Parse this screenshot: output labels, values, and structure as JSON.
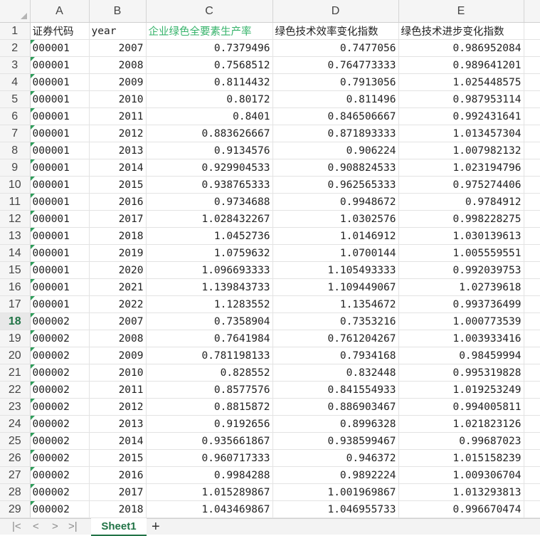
{
  "columns": [
    "A",
    "B",
    "C",
    "D",
    "E"
  ],
  "header_row": {
    "row_num": "1",
    "a": "证券代码",
    "b": "year",
    "c": "企业绿色全要素生产率",
    "d": "绿色技术效率变化指数",
    "e": "绿色技术进步变化指数"
  },
  "rows": [
    {
      "n": "2",
      "a": "000001",
      "b": "2007",
      "c": "0.7379496",
      "d": "0.7477056",
      "e": "0.986952084"
    },
    {
      "n": "3",
      "a": "000001",
      "b": "2008",
      "c": "0.7568512",
      "d": "0.764773333",
      "e": "0.989641201"
    },
    {
      "n": "4",
      "a": "000001",
      "b": "2009",
      "c": "0.8114432",
      "d": "0.7913056",
      "e": "1.025448575"
    },
    {
      "n": "5",
      "a": "000001",
      "b": "2010",
      "c": "0.80172",
      "d": "0.811496",
      "e": "0.987953114"
    },
    {
      "n": "6",
      "a": "000001",
      "b": "2011",
      "c": "0.8401",
      "d": "0.846506667",
      "e": "0.992431641"
    },
    {
      "n": "7",
      "a": "000001",
      "b": "2012",
      "c": "0.883626667",
      "d": "0.871893333",
      "e": "1.013457304"
    },
    {
      "n": "8",
      "a": "000001",
      "b": "2013",
      "c": "0.9134576",
      "d": "0.906224",
      "e": "1.007982132"
    },
    {
      "n": "9",
      "a": "000001",
      "b": "2014",
      "c": "0.929904533",
      "d": "0.908824533",
      "e": "1.023194796"
    },
    {
      "n": "10",
      "a": "000001",
      "b": "2015",
      "c": "0.938765333",
      "d": "0.962565333",
      "e": "0.975274406"
    },
    {
      "n": "11",
      "a": "000001",
      "b": "2016",
      "c": "0.9734688",
      "d": "0.9948672",
      "e": "0.9784912"
    },
    {
      "n": "12",
      "a": "000001",
      "b": "2017",
      "c": "1.028432267",
      "d": "1.0302576",
      "e": "0.998228275"
    },
    {
      "n": "13",
      "a": "000001",
      "b": "2018",
      "c": "1.0452736",
      "d": "1.0146912",
      "e": "1.030139613"
    },
    {
      "n": "14",
      "a": "000001",
      "b": "2019",
      "c": "1.0759632",
      "d": "1.0700144",
      "e": "1.005559551"
    },
    {
      "n": "15",
      "a": "000001",
      "b": "2020",
      "c": "1.096693333",
      "d": "1.105493333",
      "e": "0.992039753"
    },
    {
      "n": "16",
      "a": "000001",
      "b": "2021",
      "c": "1.139843733",
      "d": "1.109449067",
      "e": "1.02739618"
    },
    {
      "n": "17",
      "a": "000001",
      "b": "2022",
      "c": "1.1283552",
      "d": "1.1354672",
      "e": "0.993736499"
    },
    {
      "n": "18",
      "a": "000002",
      "b": "2007",
      "c": "0.7358904",
      "d": "0.7353216",
      "e": "1.000773539"
    },
    {
      "n": "19",
      "a": "000002",
      "b": "2008",
      "c": "0.7641984",
      "d": "0.761204267",
      "e": "1.003933416"
    },
    {
      "n": "20",
      "a": "000002",
      "b": "2009",
      "c": "0.781198133",
      "d": "0.7934168",
      "e": "0.98459994"
    },
    {
      "n": "21",
      "a": "000002",
      "b": "2010",
      "c": "0.828552",
      "d": "0.832448",
      "e": "0.995319828"
    },
    {
      "n": "22",
      "a": "000002",
      "b": "2011",
      "c": "0.8577576",
      "d": "0.841554933",
      "e": "1.019253249"
    },
    {
      "n": "23",
      "a": "000002",
      "b": "2012",
      "c": "0.8815872",
      "d": "0.886903467",
      "e": "0.994005811"
    },
    {
      "n": "24",
      "a": "000002",
      "b": "2013",
      "c": "0.9192656",
      "d": "0.8996328",
      "e": "1.021823126"
    },
    {
      "n": "25",
      "a": "000002",
      "b": "2014",
      "c": "0.935661867",
      "d": "0.938599467",
      "e": "0.99687023"
    },
    {
      "n": "26",
      "a": "000002",
      "b": "2015",
      "c": "0.960717333",
      "d": "0.946372",
      "e": "1.015158239"
    },
    {
      "n": "27",
      "a": "000002",
      "b": "2016",
      "c": "0.9984288",
      "d": "0.9892224",
      "e": "1.009306704"
    },
    {
      "n": "28",
      "a": "000002",
      "b": "2017",
      "c": "1.015289867",
      "d": "1.001969867",
      "e": "1.013293813"
    },
    {
      "n": "29",
      "a": "000002",
      "b": "2018",
      "c": "1.043469867",
      "d": "1.046955733",
      "e": "0.996670474"
    }
  ],
  "active_row": "18",
  "sheet_tabs": [
    "Sheet1"
  ],
  "nav_icons": [
    "first-sheet-icon",
    "prev-sheet-icon",
    "next-sheet-icon",
    "last-sheet-icon"
  ],
  "nav_glyphs": [
    "|<",
    "<",
    ">",
    ">|"
  ],
  "add_sheet_glyph": "+",
  "colors": {
    "accent": "#217346",
    "header_green": "#35b36a"
  }
}
